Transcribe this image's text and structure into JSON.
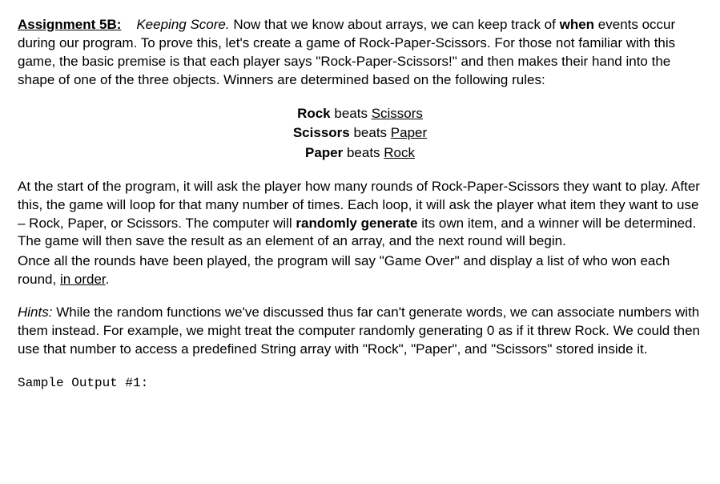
{
  "header": {
    "assignment_label": "Assignment 5B:",
    "subtitle": "Keeping Score."
  },
  "intro": {
    "part1": " Now that we know about arrays, we can keep track of ",
    "when": "when",
    "part2": " events occur during our program. To prove this, let's create a game of Rock-Paper-Scissors. For those not familiar with this game, the basic premise is that each player says \"Rock-Paper-Scissors!\" and then makes their hand into the shape of one of the three objects. Winners are determined based on the following rules:"
  },
  "rules": {
    "r1_bold": "Rock",
    "r1_mid": " beats ",
    "r1_under": "Scissors",
    "r2_bold": "Scissors",
    "r2_mid": " beats ",
    "r2_under": "Paper",
    "r3_bold": "Paper",
    "r3_mid": " beats ",
    "r3_under": "Rock"
  },
  "body": {
    "p1_a": "At the start of the program, it will ask the player how many rounds of Rock-Paper-Scissors they want to play. After this, the game will loop for that many number of times. Each loop, it will ask the player what item they want to use – Rock, Paper, or Scissors. The computer will ",
    "p1_bold": "randomly generate",
    "p1_b": " its own item, and a winner will be determined. The game will then save the result as an element of an array, and the next round will begin.",
    "p2_a": "Once all the rounds have been played, the program will say \"Game Over\" and display a list of who won each round, ",
    "p2_under": "in order",
    "p2_b": "."
  },
  "hints": {
    "label": "Hints:",
    "text": " While the random functions we've discussed thus far can't generate words, we can associate numbers with them instead. For example, we might treat the computer randomly generating 0 as if it threw Rock. We could then use that number to access a predefined String array with \"Rock\", \"Paper\", and \"Scissors\" stored inside it."
  },
  "sample": {
    "label": "Sample Output #1:"
  }
}
